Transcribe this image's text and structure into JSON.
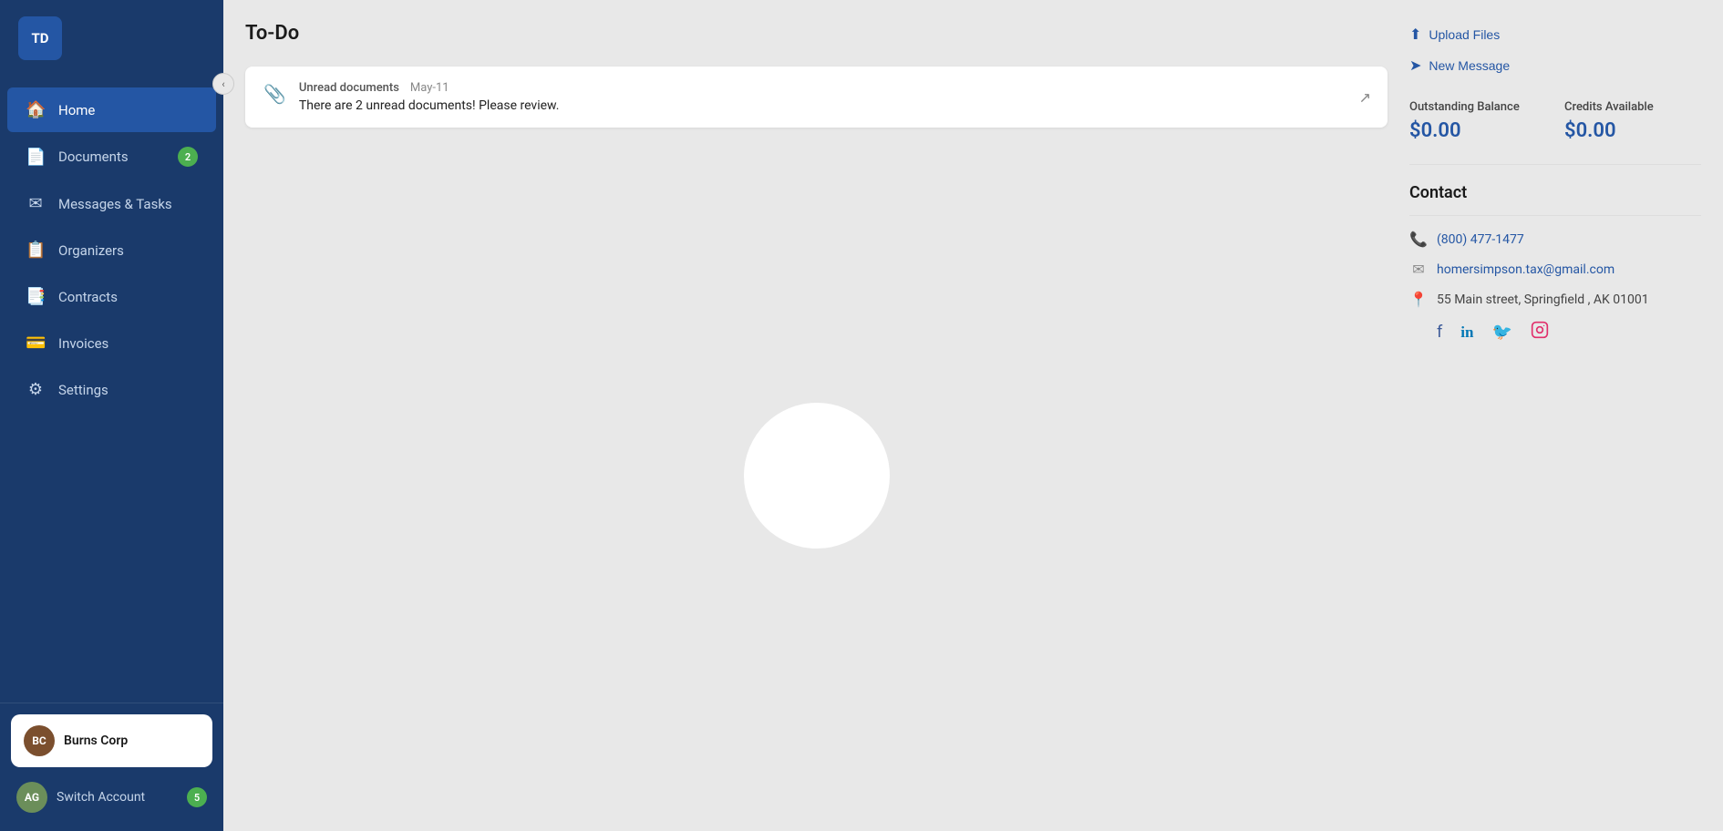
{
  "app": {
    "logo_initials": "TD",
    "title": "To-Do"
  },
  "sidebar": {
    "collapse_icon": "‹",
    "items": [
      {
        "id": "home",
        "label": "Home",
        "icon": "⌂",
        "active": true,
        "badge": null
      },
      {
        "id": "documents",
        "label": "Documents",
        "icon": "📄",
        "active": false,
        "badge": "2"
      },
      {
        "id": "messages",
        "label": "Messages & Tasks",
        "icon": "✉",
        "active": false,
        "badge": null
      },
      {
        "id": "organizers",
        "label": "Organizers",
        "icon": "📋",
        "active": false,
        "badge": null
      },
      {
        "id": "contracts",
        "label": "Contracts",
        "icon": "📑",
        "active": false,
        "badge": null
      },
      {
        "id": "invoices",
        "label": "Invoices",
        "icon": "💳",
        "active": false,
        "badge": null
      },
      {
        "id": "settings",
        "label": "Settings",
        "icon": "⚙",
        "active": false,
        "badge": null
      }
    ],
    "account": {
      "initials": "BC",
      "name": "Burns Corp"
    },
    "switch_account": {
      "initials": "AG",
      "label": "Switch Account",
      "badge": "5"
    }
  },
  "todo": {
    "label": "Unread documents",
    "date": "May-11",
    "message": "There are 2 unread documents! Please review."
  },
  "right_panel": {
    "upload_files_label": "Upload Files",
    "new_message_label": "New Message",
    "outstanding_balance_label": "Outstanding Balance",
    "outstanding_balance_value": "$0.00",
    "credits_available_label": "Credits Available",
    "credits_available_value": "$0.00",
    "contact": {
      "title": "Contact",
      "phone": "(800) 477-1477",
      "email": "homersimpson.tax@gmail.com",
      "address": "55 Main street, Springfield , AK 01001",
      "socials": {
        "facebook": "f",
        "linkedin": "in",
        "twitter": "🐦",
        "instagram": "📷"
      }
    }
  }
}
